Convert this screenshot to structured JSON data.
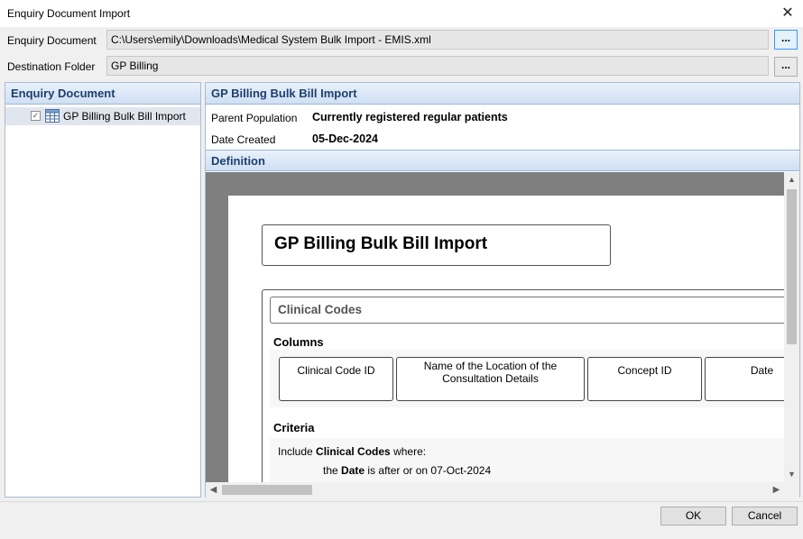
{
  "window": {
    "title": "Enquiry Document Import",
    "close_glyph": "✕"
  },
  "fields": {
    "enquiry_document_label": "Enquiry Document",
    "enquiry_document_value": "C:\\Users\\emily\\Downloads\\Medical System Bulk Import - EMIS.xml",
    "destination_folder_label": "Destination Folder",
    "destination_folder_value": "GP Billing",
    "browse_label": "..."
  },
  "left_panel": {
    "header": "Enquiry Document",
    "items": [
      {
        "label": "GP Billing Bulk Bill Import",
        "checked": true,
        "icon": "table-icon"
      }
    ]
  },
  "right_panel": {
    "header": "GP Billing Bulk Bill Import",
    "parent_population_label": "Parent Population",
    "parent_population_value": "Currently registered regular patients",
    "date_created_label": "Date Created",
    "date_created_value": "05-Dec-2024",
    "definition_header": "Definition"
  },
  "document": {
    "title": "GP Billing Bulk Bill Import",
    "section_title": "Clinical Codes",
    "columns_label": "Columns",
    "columns": [
      "Clinical Code ID",
      "Name of the Location of the Consultation Details",
      "Concept ID",
      "Date"
    ],
    "criteria_label": "Criteria",
    "criteria_line1_prefix": "Include",
    "criteria_line1_bold": "Clinical Codes",
    "criteria_line1_suffix": "where:",
    "criteria_line2_prefix": "the",
    "criteria_line2_bold": "Date",
    "criteria_line2_suffix": "is after or on 07-Oct-2024"
  },
  "buttons": {
    "ok": "OK",
    "cancel": "Cancel"
  },
  "colors": {
    "panel_header_text": "#1e3f6f",
    "panel_header_bg": "#cfdff3",
    "viewer_bg": "#7f7f7f"
  }
}
